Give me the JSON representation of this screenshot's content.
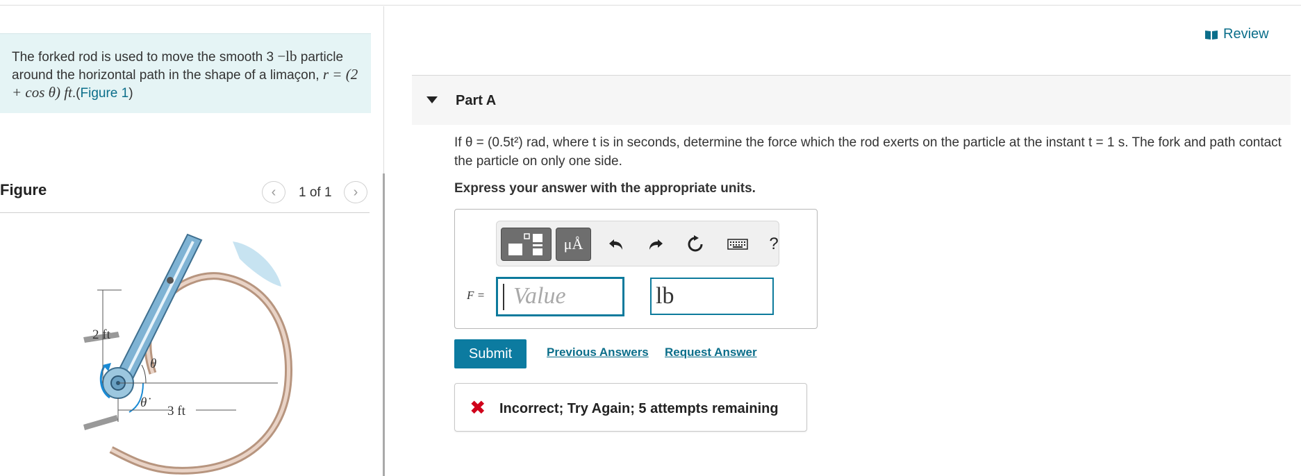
{
  "problem": {
    "text_before": "The forked rod is used to move the smooth 3",
    "weight_unit": "−lb",
    "text_middle": " particle around the horizontal path in the shape of a limaçon, ",
    "equation": "r = (2 + cos θ) ft",
    "figure_link": "Figure 1"
  },
  "figure_panel": {
    "title": "Figure",
    "page_indicator": "1 of 1",
    "labels": {
      "dim_vertical": "2 ft",
      "dim_horizontal": "3 ft",
      "theta": "θ",
      "theta_dot": "θ̇"
    }
  },
  "review": {
    "label": "Review"
  },
  "part": {
    "title": "Part A",
    "question": "If θ = (0.5t²) rad, where t is in seconds, determine the force which the rod exerts on the particle at the instant t = 1 s. The fork and path contact the particle on only one side.",
    "instruction": "Express your answer with the appropriate units."
  },
  "answer": {
    "variable": "F =",
    "value_placeholder": "Value",
    "unit": "lb",
    "toolbar": {
      "templates_icon": "templates-icon",
      "units_label": "μÅ",
      "undo_icon": "undo-icon",
      "redo_icon": "redo-icon",
      "reset_icon": "reset-icon",
      "keyboard_icon": "keyboard-icon",
      "help_label": "?"
    }
  },
  "actions": {
    "submit": "Submit",
    "previous_answers": "Previous Answers",
    "request_answer": "Request Answer"
  },
  "feedback": {
    "text": "Incorrect; Try Again; 5 attempts remaining"
  },
  "colors": {
    "accent": "#0c7ba0",
    "link": "#0b6e8a",
    "problem_bg": "#e5f4f5",
    "error": "#d0021b"
  }
}
